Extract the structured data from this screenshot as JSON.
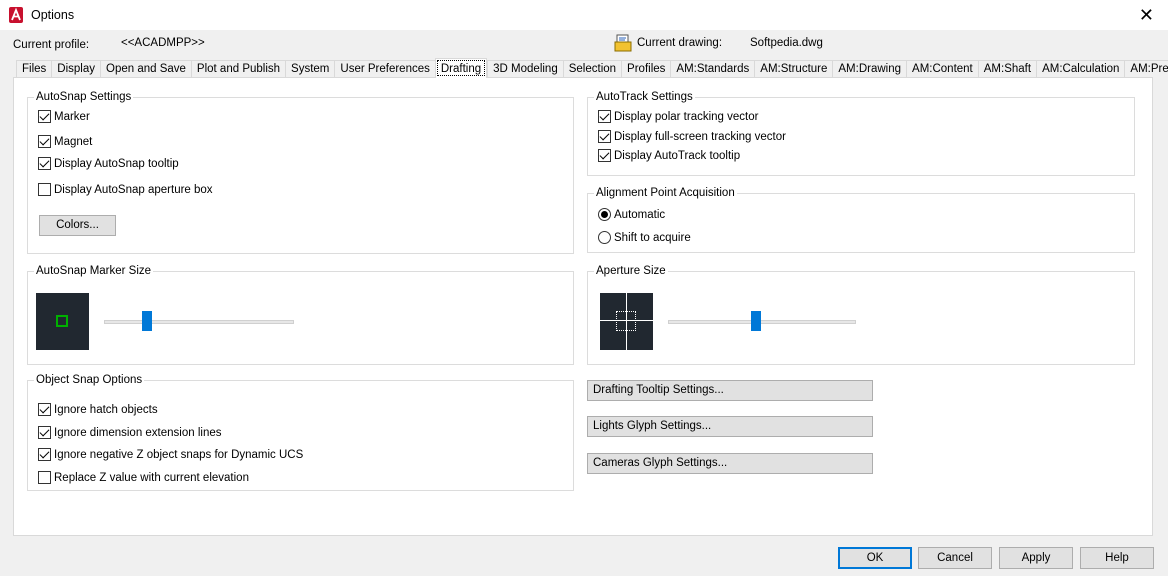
{
  "window": {
    "title": "Options",
    "close_glyph": "✕"
  },
  "profile": {
    "label": "Current profile:",
    "value": "<<ACADMPP>>"
  },
  "drawing": {
    "label": "Current drawing:",
    "value": "Softpedia.dwg"
  },
  "tabs": [
    {
      "label": "Files"
    },
    {
      "label": "Display"
    },
    {
      "label": "Open and Save"
    },
    {
      "label": "Plot and Publish"
    },
    {
      "label": "System"
    },
    {
      "label": "User Preferences"
    },
    {
      "label": "Drafting",
      "active": true
    },
    {
      "label": "3D Modeling"
    },
    {
      "label": "Selection"
    },
    {
      "label": "Profiles"
    },
    {
      "label": "AM:Standards"
    },
    {
      "label": "AM:Structure"
    },
    {
      "label": "AM:Drawing"
    },
    {
      "label": "AM:Content"
    },
    {
      "label": "AM:Shaft"
    },
    {
      "label": "AM:Calculation"
    },
    {
      "label": "AM:Preferences"
    }
  ],
  "autosnap": {
    "title": "AutoSnap Settings",
    "marker": "Marker",
    "magnet": "Magnet",
    "tooltip": "Display AutoSnap tooltip",
    "aperture_box": "Display AutoSnap aperture box",
    "colors_button": "Colors...",
    "checked": {
      "marker": true,
      "magnet": true,
      "tooltip": true,
      "aperture_box": false
    }
  },
  "autotrack": {
    "title": "AutoTrack Settings",
    "polar": "Display polar tracking vector",
    "fullscreen": "Display full-screen tracking vector",
    "tooltip": "Display AutoTrack tooltip",
    "checked": {
      "polar": true,
      "fullscreen": true,
      "tooltip": true
    }
  },
  "alignment": {
    "title": "Alignment Point Acquisition",
    "automatic": "Automatic",
    "shift": "Shift to acquire",
    "selected": "automatic"
  },
  "marker_size": {
    "title": "AutoSnap Marker Size",
    "value_fraction": 0.22
  },
  "aperture_size": {
    "title": "Aperture Size",
    "value_fraction": 0.47
  },
  "object_snap": {
    "title": "Object Snap Options",
    "hatch": "Ignore hatch objects",
    "dimension": "Ignore dimension extension lines",
    "negative_z": "Ignore negative Z object snaps for Dynamic UCS",
    "replace_z": "Replace Z value with current elevation",
    "checked": {
      "hatch": true,
      "dimension": true,
      "negative_z": true,
      "replace_z": false
    }
  },
  "buttons": {
    "drafting_tooltip": "Drafting Tooltip Settings...",
    "lights_glyph": "Lights Glyph Settings...",
    "cameras_glyph": "Cameras Glyph Settings..."
  },
  "dialog_buttons": {
    "ok": "OK",
    "cancel": "Cancel",
    "apply": "Apply",
    "help": "Help"
  },
  "colors": {
    "accent": "#0078d7",
    "preview_bg": "#212830",
    "marker_green": "#00b000"
  }
}
